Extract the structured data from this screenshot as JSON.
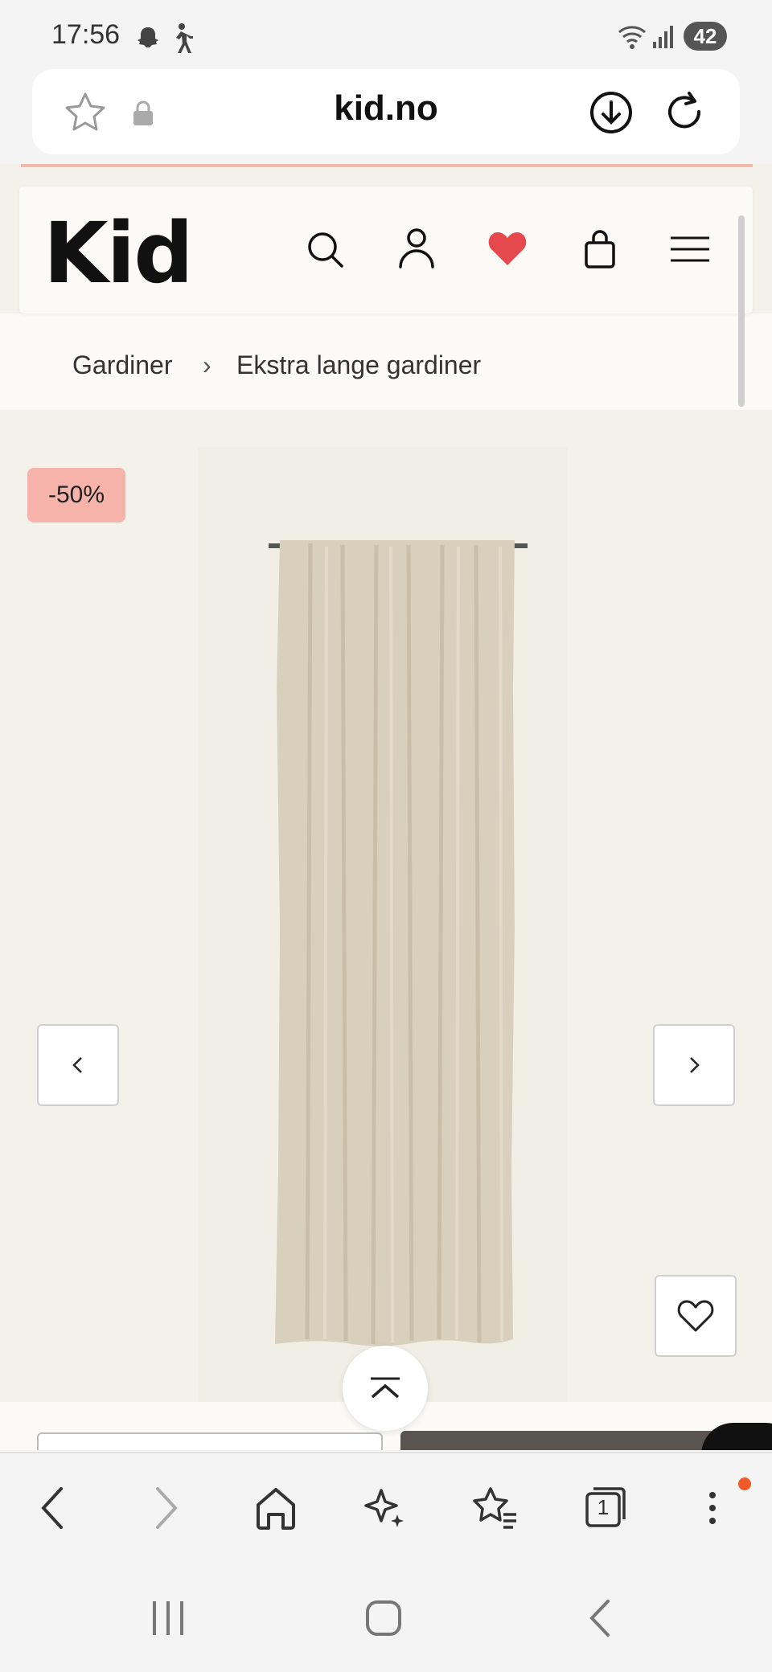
{
  "status_bar": {
    "time": "17:56",
    "battery": "42",
    "icons": [
      "snapchat-icon",
      "walking-icon",
      "wifi-icon",
      "signal-icon"
    ]
  },
  "url_bar": {
    "url": "kid.no",
    "icons": [
      "star-icon",
      "lock-icon",
      "download-icon",
      "reload-icon"
    ]
  },
  "site": {
    "logo": "Kid",
    "header_icons": [
      "search-icon",
      "account-icon",
      "heart-icon",
      "bag-icon",
      "menu-icon"
    ],
    "breadcrumb": [
      "Gardiner",
      "›",
      "Ekstra lange gardiner"
    ]
  },
  "product": {
    "discount_badge": "-50%"
  },
  "browser_nav": {
    "icons": [
      "back-icon",
      "forward-icon",
      "home-icon",
      "sparkle-icon",
      "bookmarks-icon",
      "tabs-icon",
      "more-icon"
    ],
    "tab_count": "1"
  },
  "colors": {
    "page_bg": "#f3f1ea",
    "discount": "#f6b3aa",
    "heart": "#e5484d",
    "curtain": "#d9cfbd"
  }
}
